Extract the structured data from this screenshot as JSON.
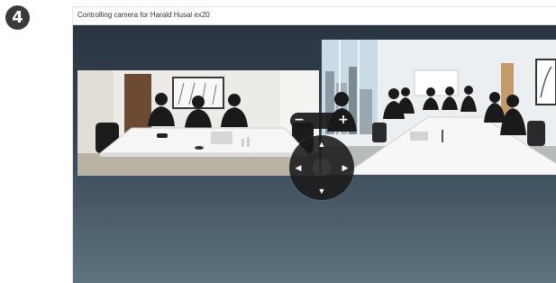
{
  "step": {
    "number": "4"
  },
  "window": {
    "title": "Controlling camera for Harald Husal ex20"
  },
  "camera_control": {
    "zoom_out_label": "−",
    "zoom_in_label": "+",
    "up_label": "▲",
    "down_label": "▼",
    "left_label": "◀",
    "right_label": "▶"
  },
  "feeds": {
    "left": {
      "name": "remote-meeting-room-video",
      "people_visible": 3
    },
    "right": {
      "name": "local-meeting-room-video",
      "people_visible": 8
    }
  },
  "colors": {
    "stage_top": "#2a3540",
    "stage_bottom": "#5e7380",
    "control_bg": "#191919",
    "badge_bg": "#3a3a3a"
  }
}
